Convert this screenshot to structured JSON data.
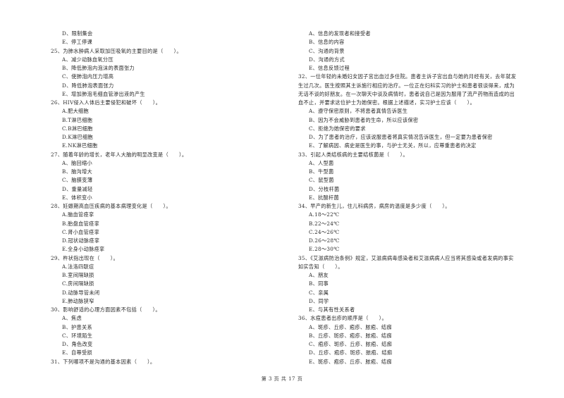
{
  "left_column": {
    "items": [
      {
        "type": "opt",
        "text": "D、限制集会"
      },
      {
        "type": "opt",
        "text": "E、停工停课"
      },
      {
        "type": "q",
        "text": "25、为肺水肿病人采取加压吸氧的主要目的是（　　）。"
      },
      {
        "type": "opt",
        "text": "A、减少动脉血氧分压"
      },
      {
        "type": "opt",
        "text": "B、降低肺泡内泡沫的表面张力"
      },
      {
        "type": "opt",
        "text": "C、使肺泡内压力增高"
      },
      {
        "type": "opt",
        "text": "D、降低肺泡表面张力"
      },
      {
        "type": "opt",
        "text": "E、增加肺泡毛细血管渗出液的产生"
      },
      {
        "type": "q",
        "text": "26、HIV侵入人体后主要侵犯和破坏（　　）。"
      },
      {
        "type": "opt",
        "text": "A.肥大细胞"
      },
      {
        "type": "opt",
        "text": "B.T淋巴细胞"
      },
      {
        "type": "opt",
        "text": "C.B淋巴细胞"
      },
      {
        "type": "opt",
        "text": "D.K淋巴细胞"
      },
      {
        "type": "opt",
        "text": "E.NK淋巴细胞"
      },
      {
        "type": "q",
        "text": "27、随着年龄的增长，老年人大脑的明显改变是（　　）。"
      },
      {
        "type": "opt",
        "text": "A、脑回缩小"
      },
      {
        "type": "opt",
        "text": "B、脑沟增大"
      },
      {
        "type": "opt",
        "text": "C、脑膜变薄"
      },
      {
        "type": "opt",
        "text": "D、重量减轻"
      },
      {
        "type": "opt",
        "text": "E、体积变小"
      },
      {
        "type": "q",
        "text": "28、妊娠期高血压疾病的基本病理变化是（　　）。"
      },
      {
        "type": "opt",
        "text": "A.脑血管痉挛"
      },
      {
        "type": "opt",
        "text": "B.胎盘血管痉挛"
      },
      {
        "type": "opt",
        "text": "C.肾小血管痉挛"
      },
      {
        "type": "opt",
        "text": "D.冠状动脉痉挛"
      },
      {
        "type": "opt",
        "text": "E.全身小动脉痉挛"
      },
      {
        "type": "q",
        "text": "29、杵状指出现在（　　）。"
      },
      {
        "type": "opt",
        "text": "A.法洛四联症"
      },
      {
        "type": "opt",
        "text": "B.室间隔缺损"
      },
      {
        "type": "opt",
        "text": "C.房间隔缺损"
      },
      {
        "type": "opt",
        "text": "D.动脉导管未闭"
      },
      {
        "type": "opt",
        "text": "E.肺动脉狭窄"
      },
      {
        "type": "q",
        "text": "30、影响舒适的心理方面因素不包括（　　）。"
      },
      {
        "type": "opt",
        "text": "A、焦虑"
      },
      {
        "type": "opt",
        "text": "B、护患关系"
      },
      {
        "type": "opt",
        "text": "C、环境陌生"
      },
      {
        "type": "opt",
        "text": "D、角色改变"
      },
      {
        "type": "opt",
        "text": "E、自尊受损"
      },
      {
        "type": "q",
        "text": "31、下列哪项不是沟通的基本因素（　　）。"
      }
    ]
  },
  "right_column": {
    "items": [
      {
        "type": "opt",
        "text": "A、信息的发现者和接受者"
      },
      {
        "type": "opt",
        "text": "B、信息的内容"
      },
      {
        "type": "opt",
        "text": "C、沟通的背景"
      },
      {
        "type": "opt",
        "text": "D、沟通的方式"
      },
      {
        "type": "opt",
        "text": "E、信息反馈过程"
      },
      {
        "type": "q",
        "text": "32、一位年轻的未婚妇女因子宫出血过多住院。患者主诉子宫出血与她的月经有关，去年就发"
      },
      {
        "type": "q",
        "text": "生过几次。医生按照其主诉施行相应的治疗。一位正在妇科实习的护士和患者很谈得来，成为"
      },
      {
        "type": "q",
        "text": "无话不谈的好朋友。在一次聊天中谈及病情时，患者说自己是因为服用了流产药物而造成的出"
      },
      {
        "type": "q",
        "text": "血不止，并要求这位护士为她保密。根据上述描述，实习护士应该（　　）。"
      },
      {
        "type": "opt",
        "text": "A、遵守保密原则，不将患者真情告诉医生"
      },
      {
        "type": "opt",
        "text": "B、因为不会威胁到患者的生命，所以应该保密"
      },
      {
        "type": "opt",
        "text": "C、拒绝为她保密的要求"
      },
      {
        "type": "opt",
        "text": "D、为了患者的治疗，应该说服患者将真实情况告诉医生，但一定要为患者保密"
      },
      {
        "type": "opt",
        "text": "E、了解病因、病史是医生的事，与护士无关，所以，应尊重患者的决定"
      },
      {
        "type": "q",
        "text": "33、引起人类结核病的主要结核菌是（　　）。"
      },
      {
        "type": "opt",
        "text": "A、人型菌"
      },
      {
        "type": "opt",
        "text": "B、牛型菌"
      },
      {
        "type": "opt",
        "text": "C、鼠型菌"
      },
      {
        "type": "opt",
        "text": "D、分枝杆菌"
      },
      {
        "type": "opt",
        "text": "E、抗酸杆菌"
      },
      {
        "type": "q",
        "text": "34、早产的新生儿，住儿科病房，病房的温度是多少度（　　）。"
      },
      {
        "type": "opt",
        "text": "A.18～22℃"
      },
      {
        "type": "opt",
        "text": "B.22～24℃"
      },
      {
        "type": "opt",
        "text": "C.24～26℃"
      },
      {
        "type": "opt",
        "text": "D.26～28℃"
      },
      {
        "type": "opt",
        "text": "E.28～30℃"
      },
      {
        "type": "q",
        "text": "35、《艾滋病防治条例》规定，艾滋病病毒感染者和艾滋病病人应当将其感染或者发病的事实"
      },
      {
        "type": "q",
        "text": "如实告知（　　）。"
      },
      {
        "type": "opt",
        "text": "A、朋友"
      },
      {
        "type": "opt",
        "text": "B、同事"
      },
      {
        "type": "opt",
        "text": "C、亲属"
      },
      {
        "type": "opt",
        "text": "D、同学"
      },
      {
        "type": "opt",
        "text": "E、与其有性关系者"
      },
      {
        "type": "q",
        "text": "36、水痘患者出疹的顺序是（　　）。"
      },
      {
        "type": "opt",
        "text": "A、斑疹、丘疹、疱疹、脓疱、结痂"
      },
      {
        "type": "opt",
        "text": "B、丘疹、斑疹、疱疹、脓疱、结痂"
      },
      {
        "type": "opt",
        "text": "C、疱疹、斑疹、丘疹、脓疱、结痂"
      },
      {
        "type": "opt",
        "text": "D、丘疹、疱疹、斑疹、脓疱、结痂"
      },
      {
        "type": "opt",
        "text": "E、斑疹、疱疹、丘疹、脓疱、结痂"
      }
    ]
  },
  "footer": {
    "page_label": "第 3 页 共 17 页"
  }
}
